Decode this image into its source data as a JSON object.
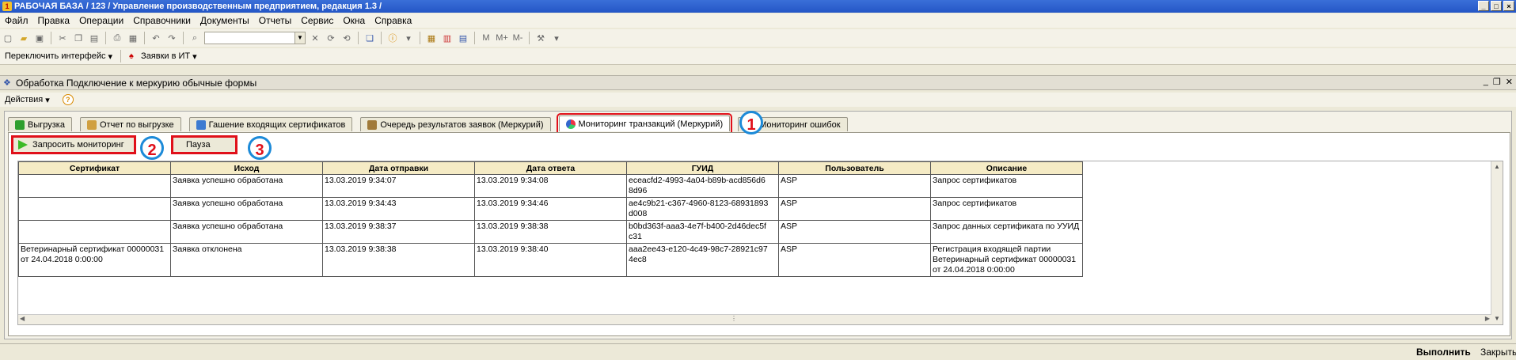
{
  "window": {
    "title": "РАБОЧАЯ БАЗА / 123 / Управление производственным предприятием, редакция 1.3 /"
  },
  "menubar": {
    "items": [
      "Файл",
      "Правка",
      "Операции",
      "Справочники",
      "Документы",
      "Отчеты",
      "Сервис",
      "Окна",
      "Справка"
    ]
  },
  "toolbar2": {
    "switch_interface": "Переключить интерфейс",
    "requests_it": "Заявки в ИТ"
  },
  "form": {
    "title": "Обработка  Подключение к меркурию обычные формы",
    "actions_label": "Действия"
  },
  "tabs": [
    {
      "label": "Выгрузка",
      "color": "#2e9e2e"
    },
    {
      "label": "Отчет по выгрузке",
      "color": "#d0a040"
    },
    {
      "label": "Гашение входящих сертификатов",
      "color": "#3d7bd1"
    },
    {
      "label": "Очередь результатов заявок (Меркурий)",
      "color": "#a07a3a"
    },
    {
      "label": "Мониторинг транзакций (Меркурий)",
      "color": "#3d7bd1"
    },
    {
      "label": "Мониторинг ошибок",
      "color": ""
    }
  ],
  "commands": {
    "request_monitoring": "Запросить мониторинг",
    "pause": "Пауза"
  },
  "callouts": [
    "1",
    "2",
    "3"
  ],
  "table": {
    "columns": [
      "Сертификат",
      "Исход",
      "Дата отправки",
      "Дата ответа",
      "ГУИД",
      "Пользователь",
      "Описание"
    ],
    "rows": [
      {
        "certificate": "",
        "outcome": "Заявка успешно обработана",
        "sent": "13.03.2019 9:34:07",
        "answered": "13.03.2019 9:34:08",
        "guid": "eceacfd2-4993-4a04-b89b-acd856d6 8d96",
        "user": "ASP",
        "description": "Запрос сертификатов"
      },
      {
        "certificate": "",
        "outcome": "Заявка успешно обработана",
        "sent": "13.03.2019 9:34:43",
        "answered": "13.03.2019 9:34:46",
        "guid": "ae4c9b21-c367-4960-8123-68931893 d008",
        "user": "ASP",
        "description": "Запрос сертификатов"
      },
      {
        "certificate": "",
        "outcome": "Заявка успешно обработана",
        "sent": "13.03.2019 9:38:37",
        "answered": "13.03.2019 9:38:38",
        "guid": "b0bd363f-aaa3-4e7f-b400-2d46dec5f c31",
        "user": "ASP",
        "description": "Запрос данных сертификата по УУИД"
      },
      {
        "certificate": "Ветеринарный сертификат 00000031 от 24.04.2018 0:00:00",
        "outcome": "Заявка отклонена",
        "sent": "13.03.2019 9:38:38",
        "answered": "13.03.2019 9:38:40",
        "guid": "aaa2ee43-e120-4c49-98c7-28921c97 4ec8",
        "user": "ASP",
        "description": "Регистрация входящей партии Ветеринарный сертификат 00000031 от 24.04.2018 0:00:00"
      }
    ]
  },
  "bottom": {
    "execute": "Выполнить",
    "close": "Закрыть"
  },
  "colors": {
    "highlight": "#e0101a",
    "callout_ring": "#1c8ad8",
    "header_bg": "#f5ebc5"
  }
}
